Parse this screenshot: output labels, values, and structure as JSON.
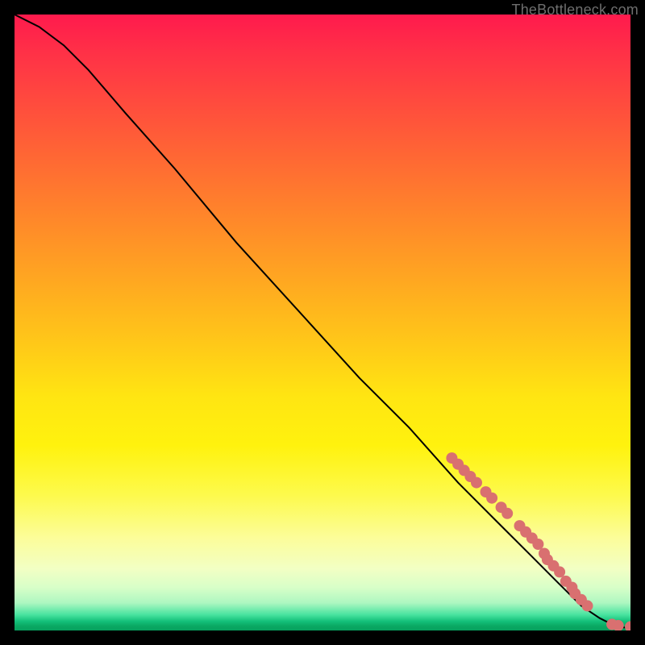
{
  "watermark": "TheBottleneck.com",
  "chart_data": {
    "type": "line",
    "title": "",
    "xlabel": "",
    "ylabel": "",
    "xlim": [
      0,
      100
    ],
    "ylim": [
      0,
      100
    ],
    "series": [
      {
        "name": "curve",
        "color": "#000000",
        "x": [
          0,
          4,
          8,
          12,
          18,
          26,
          36,
          46,
          56,
          64,
          72,
          78,
          84,
          88,
          92,
          95,
          97,
          98.5,
          100
        ],
        "values": [
          100,
          98,
          95,
          91,
          84,
          75,
          63,
          52,
          41,
          33,
          24,
          18,
          12,
          8,
          4,
          2,
          1,
          0.5,
          0.5
        ]
      }
    ],
    "scatter": {
      "name": "markers",
      "color": "#d97070",
      "radius": 7,
      "points": [
        {
          "x": 71.0,
          "y": 28.0
        },
        {
          "x": 72.0,
          "y": 27.0
        },
        {
          "x": 73.0,
          "y": 26.0
        },
        {
          "x": 74.0,
          "y": 25.0
        },
        {
          "x": 75.0,
          "y": 24.0
        },
        {
          "x": 76.5,
          "y": 22.5
        },
        {
          "x": 77.5,
          "y": 21.5
        },
        {
          "x": 79.0,
          "y": 20.0
        },
        {
          "x": 80.0,
          "y": 19.0
        },
        {
          "x": 82.0,
          "y": 17.0
        },
        {
          "x": 83.0,
          "y": 16.0
        },
        {
          "x": 84.0,
          "y": 15.0
        },
        {
          "x": 85.0,
          "y": 14.0
        },
        {
          "x": 86.0,
          "y": 12.5
        },
        {
          "x": 86.5,
          "y": 11.5
        },
        {
          "x": 87.5,
          "y": 10.5
        },
        {
          "x": 88.5,
          "y": 9.5
        },
        {
          "x": 89.5,
          "y": 8.0
        },
        {
          "x": 90.5,
          "y": 7.0
        },
        {
          "x": 91.0,
          "y": 6.0
        },
        {
          "x": 92.0,
          "y": 5.0
        },
        {
          "x": 93.0,
          "y": 4.0
        },
        {
          "x": 97.0,
          "y": 1.0
        },
        {
          "x": 98.0,
          "y": 0.8
        },
        {
          "x": 100.0,
          "y": 0.6
        }
      ]
    }
  }
}
